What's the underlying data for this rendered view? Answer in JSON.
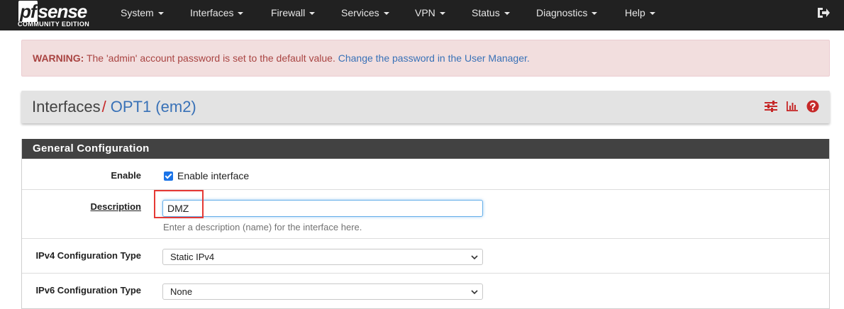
{
  "brand": {
    "logo_text": "pfsense",
    "edition": "COMMUNITY EDITION"
  },
  "nav": {
    "items": [
      {
        "label": "System"
      },
      {
        "label": "Interfaces"
      },
      {
        "label": "Firewall"
      },
      {
        "label": "Services"
      },
      {
        "label": "VPN"
      },
      {
        "label": "Status"
      },
      {
        "label": "Diagnostics"
      },
      {
        "label": "Help"
      }
    ],
    "logout_icon": "sign-out-icon"
  },
  "alert": {
    "prefix": "WARNING:",
    "message": " The 'admin' account password is set to the default value. ",
    "link": "Change the password in the User Manager."
  },
  "breadcrumb": {
    "root": "Interfaces",
    "separator": "/",
    "current": "OPT1 (em2)",
    "icons": [
      "sliders-icon",
      "bar-chart-icon",
      "help-circle-icon"
    ]
  },
  "panel": {
    "title": "General Configuration",
    "enable": {
      "label": "Enable",
      "checked": true,
      "checkbox_label": "Enable interface"
    },
    "description": {
      "label": "Description",
      "value": "DMZ",
      "help": "Enter a description (name) for the interface here."
    },
    "ipv4": {
      "label": "IPv4 Configuration Type",
      "selected": "Static IPv4"
    },
    "ipv6": {
      "label": "IPv6 Configuration Type",
      "selected": "None"
    }
  },
  "colors": {
    "navbar": "#212121",
    "alert_bg": "#f2dede",
    "alert_text": "#a94442",
    "link": "#3871b7",
    "accent_red": "#c62828",
    "panel_heading": "#424242"
  }
}
